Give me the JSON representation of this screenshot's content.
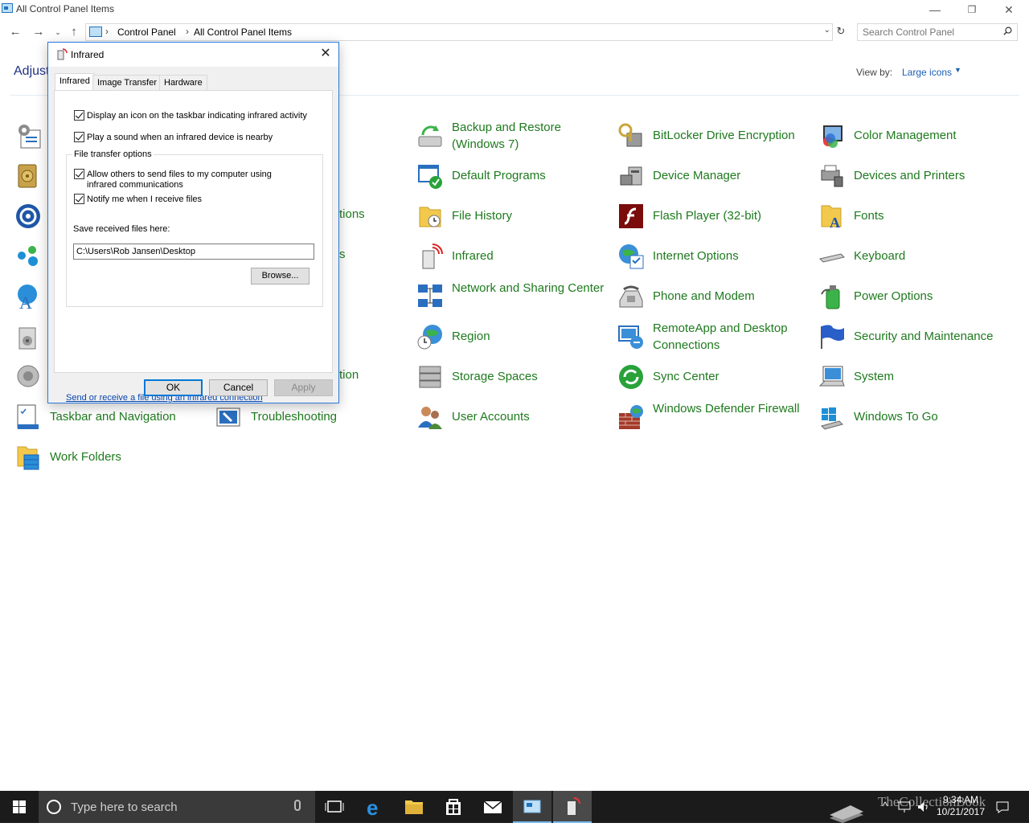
{
  "window": {
    "title": "All Control Panel Items",
    "minimize_glyph": "—",
    "restore_glyph": "❐",
    "close_glyph": "✕"
  },
  "address": {
    "crumbs": [
      "Control Panel",
      "All Control Panel Items"
    ],
    "search_placeholder": "Search Control Panel"
  },
  "main": {
    "heading_partial": "Adjust",
    "view_by_label": "View by:",
    "view_by_value": "Large icons",
    "partial_labels": [
      "tions",
      "s",
      "tion"
    ]
  },
  "items": [
    {
      "label": "Backup and Restore (Windows 7)",
      "icon": "backup-restore-icon"
    },
    {
      "label": "BitLocker Drive Encryption",
      "icon": "bitlocker-icon"
    },
    {
      "label": "Color Management",
      "icon": "color-management-icon"
    },
    {
      "label": "Default Programs",
      "icon": "default-programs-icon"
    },
    {
      "label": "Device Manager",
      "icon": "device-manager-icon"
    },
    {
      "label": "Devices and Printers",
      "icon": "devices-printers-icon"
    },
    {
      "label": "File History",
      "icon": "file-history-icon"
    },
    {
      "label": "Flash Player (32-bit)",
      "icon": "flash-player-icon"
    },
    {
      "label": "Fonts",
      "icon": "fonts-icon"
    },
    {
      "label": "Infrared",
      "icon": "infrared-icon"
    },
    {
      "label": "Internet Options",
      "icon": "internet-options-icon"
    },
    {
      "label": "Keyboard",
      "icon": "keyboard-icon"
    },
    {
      "label": "Network and Sharing Center",
      "icon": "network-sharing-icon"
    },
    {
      "label": "Phone and Modem",
      "icon": "phone-modem-icon"
    },
    {
      "label": "Power Options",
      "icon": "power-options-icon"
    },
    {
      "label": "Region",
      "icon": "region-icon"
    },
    {
      "label": "RemoteApp and Desktop Connections",
      "icon": "remoteapp-icon"
    },
    {
      "label": "Security and Maintenance",
      "icon": "security-maintenance-icon"
    },
    {
      "label": "Storage Spaces",
      "icon": "storage-spaces-icon"
    },
    {
      "label": "Sync Center",
      "icon": "sync-center-icon"
    },
    {
      "label": "System",
      "icon": "system-icon"
    },
    {
      "label": "Taskbar and Navigation",
      "icon": "taskbar-navigation-icon"
    },
    {
      "label": "Troubleshooting",
      "icon": "troubleshooting-icon"
    },
    {
      "label": "User Accounts",
      "icon": "user-accounts-icon"
    },
    {
      "label": "Windows Defender Firewall",
      "icon": "firewall-icon"
    },
    {
      "label": "Windows To Go",
      "icon": "windows-to-go-icon"
    },
    {
      "label": "Work Folders",
      "icon": "work-folders-icon"
    }
  ],
  "dialog": {
    "title": "Infrared",
    "close_glyph": "✕",
    "tabs": [
      "Infrared",
      "Image Transfer",
      "Hardware"
    ],
    "checkboxes": [
      {
        "label": "Display an icon on the taskbar indicating infrared activity",
        "checked": true
      },
      {
        "label": "Play a sound when an infrared device is nearby",
        "checked": true
      },
      {
        "label": "Allow others to send files to my computer using infrared communications",
        "checked": true
      },
      {
        "label": "Notify me when I receive files",
        "checked": true
      }
    ],
    "group_title": "File transfer options",
    "save_label": "Save received files here:",
    "save_path": "C:\\Users\\Rob Jansen\\Desktop",
    "browse_label": "Browse...",
    "link_text": "Send or receive a file using an infrared connection",
    "ok_label": "OK",
    "cancel_label": "Cancel",
    "apply_label": "Apply"
  },
  "taskbar": {
    "search_placeholder": "Type here to search",
    "time": "9:34 AM",
    "date": "10/21/2017",
    "watermark": "TheCollectionBook"
  },
  "colors": {
    "item_label": "#1e7a1e",
    "link": "#1a5fb4",
    "dialog_border": "#2b79d8",
    "taskbar": "#1b1b1b"
  }
}
